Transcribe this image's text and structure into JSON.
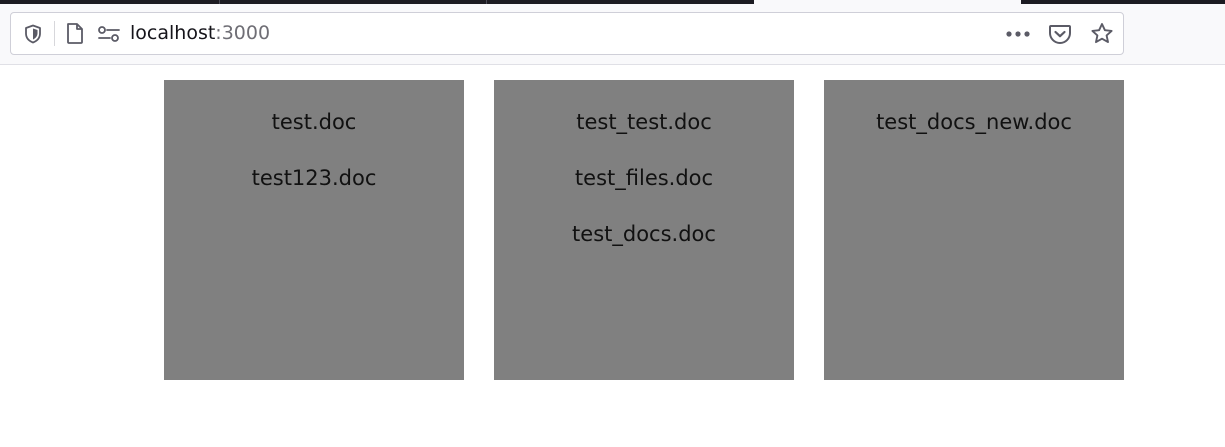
{
  "browser": {
    "url_host": "localhost",
    "url_port": ":3000",
    "icons": {
      "tracking": "shield-icon",
      "page": "page-icon",
      "permissions": "permissions-icon",
      "more": "more-icon",
      "pocket": "pocket-icon",
      "bookmark": "star-icon"
    },
    "colors": {
      "tab_strip": "#1c1b22",
      "active_tab": "#f9f9fb"
    }
  },
  "folders": [
    {
      "files": [
        "test.doc",
        "test123.doc"
      ]
    },
    {
      "files": [
        "test_test.doc",
        "test_files.doc",
        "test_docs.doc"
      ]
    },
    {
      "files": [
        "test_docs_new.doc"
      ]
    }
  ],
  "colors": {
    "card_background": "#808080",
    "file_text": "#111111"
  }
}
